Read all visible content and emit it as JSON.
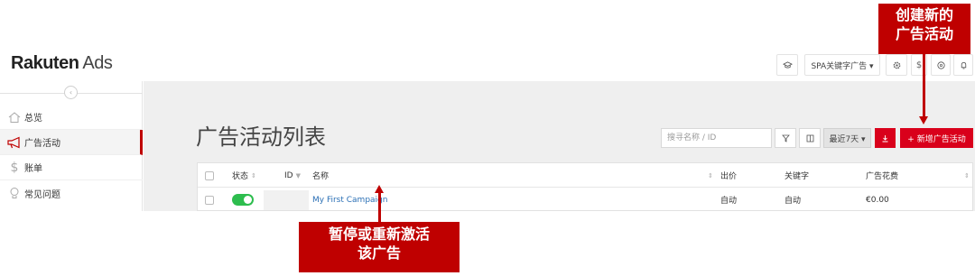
{
  "header": {
    "logo_brand": "Rakuten",
    "logo_suffix": "Ads",
    "account_dropdown": "SPA关键字广告 ▾",
    "icons": [
      "graduation-cap-icon",
      "gear-icon",
      "dollar-icon",
      "help-icon",
      "bell-icon"
    ]
  },
  "sidebar": {
    "items": [
      {
        "label": "总览",
        "icon": "home-icon"
      },
      {
        "label": "广告活动",
        "icon": "megaphone-icon"
      },
      {
        "label": "账单",
        "icon": "dollar-icon"
      },
      {
        "label": "常见问题",
        "icon": "lightbulb-icon"
      }
    ],
    "active_index": 1
  },
  "main": {
    "title": "广告活动列表",
    "search_placeholder": "搜寻名称 / ID",
    "date_range": "最近7天 ▾",
    "download_icon": "download-icon",
    "new_campaign_label": "+ 新增广告活动"
  },
  "table": {
    "headers": {
      "status": "状态",
      "id": "ID",
      "name": "名称",
      "bid": "出价",
      "keyword": "关键字",
      "spend": "广告花费"
    },
    "rows": [
      {
        "status": "on",
        "id": "",
        "name": "My First Campaign",
        "bid": "自动",
        "keyword": "自动",
        "spend": "€0.00"
      }
    ]
  },
  "annotations": {
    "create_campaign": [
      "创建新的",
      "广告活动"
    ],
    "toggle_campaign": [
      "暂停或重新激活",
      "该广告"
    ]
  },
  "colors": {
    "brand_red": "#bf0000",
    "button_red": "#d9001b",
    "toggle_green": "#2dbd4e",
    "link_blue": "#2a6fb5"
  }
}
